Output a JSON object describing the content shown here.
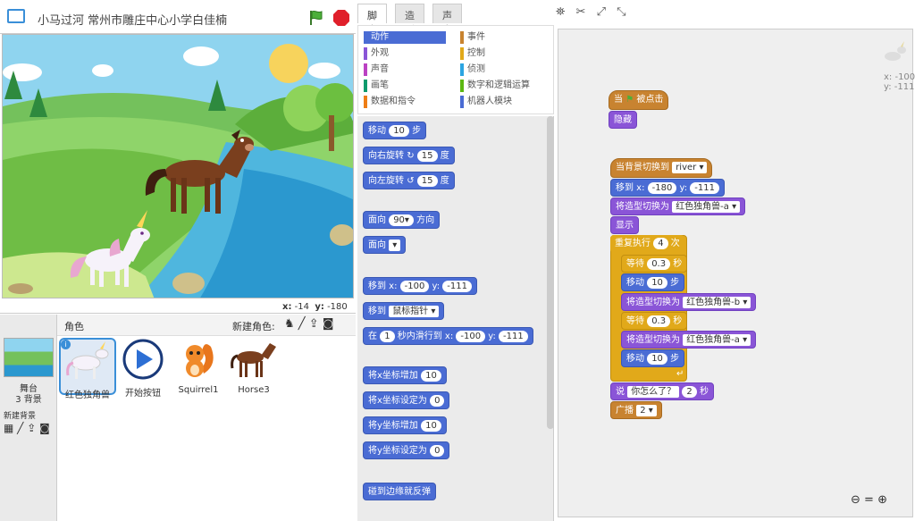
{
  "stage": {
    "title": "小马过河 常州市雕庄中心小学白佳楠",
    "x_label": "x:",
    "x_value": "-14",
    "y_label": "y:",
    "y_value": "-180"
  },
  "sprites": {
    "header": "角色",
    "new_sprite_label": "新建角色:",
    "stage_label": "舞台",
    "backdrop_count": "3 背景",
    "new_backdrop_label": "新建背景",
    "items": [
      {
        "name": "红色独角兽",
        "selected": true
      },
      {
        "name": "开始按钮"
      },
      {
        "name": "Squirrel1"
      },
      {
        "name": "Horse3"
      }
    ]
  },
  "tabs": [
    "脚本",
    "造型",
    "声音"
  ],
  "categories": {
    "left": [
      {
        "label": "动作",
        "color": "#4a6cd4",
        "active": true
      },
      {
        "label": "外观",
        "color": "#8a55d7"
      },
      {
        "label": "声音",
        "color": "#bb42c3"
      },
      {
        "label": "画笔",
        "color": "#0e9a6c"
      },
      {
        "label": "数据和指令",
        "color": "#ee7d16"
      }
    ],
    "right": [
      {
        "label": "事件",
        "color": "#c88330"
      },
      {
        "label": "控制",
        "color": "#e1a91a"
      },
      {
        "label": "侦测",
        "color": "#2ca5e2"
      },
      {
        "label": "数字和逻辑运算",
        "color": "#5cb712"
      },
      {
        "label": "机器人模块",
        "color": "#4a6cd4"
      }
    ]
  },
  "palette": {
    "move": {
      "a": "移动",
      "v": "10",
      "b": "步"
    },
    "turn_right": {
      "a": "向右旋转",
      "v": "15",
      "b": "度"
    },
    "turn_left": {
      "a": "向左旋转",
      "v": "15",
      "b": "度"
    },
    "point_dir": {
      "a": "面向",
      "v": "90▾",
      "b": "方向"
    },
    "point_towards": {
      "a": "面向",
      "v": "▾"
    },
    "goto_xy": {
      "a": "移到 x:",
      "x": "-100",
      "b": "y:",
      "y": "-111"
    },
    "goto": {
      "a": "移到",
      "v": "鼠标指针 ▾"
    },
    "glide": {
      "a": "在",
      "t": "1",
      "b": "秒内滑行到 x:",
      "x": "-100",
      "c": "y:",
      "y": "-111"
    },
    "change_x": {
      "a": "将x坐标增加",
      "v": "10"
    },
    "set_x": {
      "a": "将x坐标设定为",
      "v": "0"
    },
    "change_y": {
      "a": "将y坐标增加",
      "v": "10"
    },
    "set_y": {
      "a": "将y坐标设定为",
      "v": "0"
    },
    "bounce": {
      "a": "碰到边缘就反弹"
    }
  },
  "scripts": {
    "hat1": {
      "a": "当",
      "b": "被点击"
    },
    "hide": "隐藏",
    "hat2": {
      "a": "当背景切换到",
      "v": "river ▾"
    },
    "goto_xy": {
      "a": "移到 x:",
      "x": "-180",
      "b": "y:",
      "y": "-111"
    },
    "costume1": {
      "a": "将造型切换为",
      "v": "红色独角兽-a ▾"
    },
    "show": "显示",
    "repeat": {
      "a": "重复执行",
      "v": "4",
      "b": "次"
    },
    "wait1": {
      "a": "等待",
      "v": "0.3",
      "b": "秒"
    },
    "move1": {
      "a": "移动",
      "v": "10",
      "b": "步"
    },
    "costume2": {
      "a": "将造型切换为",
      "v": "红色独角兽-b ▾"
    },
    "wait2": {
      "a": "等待",
      "v": "0.3",
      "b": "秒"
    },
    "costume3": {
      "a": "将造型切换为",
      "v": "红色独角兽-a ▾"
    },
    "move2": {
      "a": "移动",
      "v": "10",
      "b": "步"
    },
    "say": {
      "a": "说",
      "v": "你怎么了？",
      "t": "2",
      "b": "秒"
    },
    "broadcast": {
      "a": "广播",
      "v": "2 ▾"
    }
  },
  "sprite_xy": {
    "x": "x: -100",
    "y": "y: -111"
  }
}
